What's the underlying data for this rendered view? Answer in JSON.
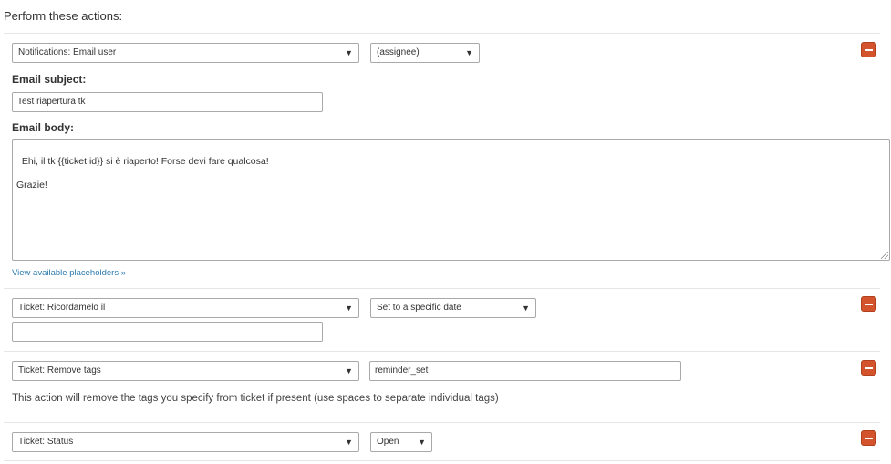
{
  "heading": "Perform these actions:",
  "action1": {
    "action_select": "Notifications: Email user",
    "target_select": "(assignee)",
    "subject_label": "Email subject:",
    "subject_value": "Test riapertura tk",
    "body_label": "Email body:",
    "body_value": "Ehi, il tk {{ticket.id}} si è riaperto! Forse devi fare qualcosa!\n\nGrazie!",
    "placeholders_link": "View available placeholders »"
  },
  "action2": {
    "action_select": "Ticket: Ricordamelo il",
    "option_select": "Set to a specific date",
    "date_value": ""
  },
  "action3": {
    "action_select": "Ticket: Remove tags",
    "tags_value": "reminder_set",
    "help_text": "This action will remove the tags you specify from ticket if present (use spaces to separate individual tags)"
  },
  "action4": {
    "action_select": "Ticket: Status",
    "status_select": "Open"
  },
  "icons": {
    "dropdown": "caret-down-icon",
    "remove": "minus-icon"
  },
  "colors": {
    "remove_button": "#d2532c",
    "link": "#2a7ab0"
  }
}
